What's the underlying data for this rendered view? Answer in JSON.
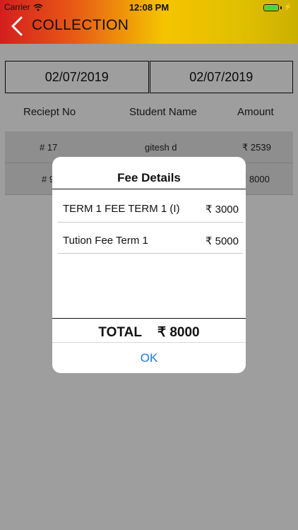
{
  "status_bar": {
    "carrier": "Carrier",
    "time": "12:08 PM"
  },
  "header": {
    "title": "COLLECTION"
  },
  "filters": {
    "from_date": "02/07/2019",
    "to_date": "02/07/2019"
  },
  "table": {
    "columns": [
      "Reciept No",
      "Student Name",
      "Amount"
    ],
    "rows": [
      {
        "receipt": "# 17",
        "student": "gitesh d",
        "amount": "₹ 2539"
      },
      {
        "receipt": "# 9",
        "student": "",
        "amount": "₹ 8000"
      }
    ]
  },
  "modal": {
    "title": "Fee Details",
    "items": [
      {
        "label": "TERM 1 FEE TERM 1 (I)",
        "amount": "₹ 3000"
      },
      {
        "label": "Tution Fee Term 1",
        "amount": "₹ 5000"
      }
    ],
    "total_label": "TOTAL",
    "total_amount": "₹ 8000",
    "ok_label": "OK"
  },
  "colors": {
    "accent_blue": "#1a7ae0",
    "header_red": "#d41e1e",
    "header_yellow": "#f5c400",
    "battery_green": "#3ddc3d"
  }
}
